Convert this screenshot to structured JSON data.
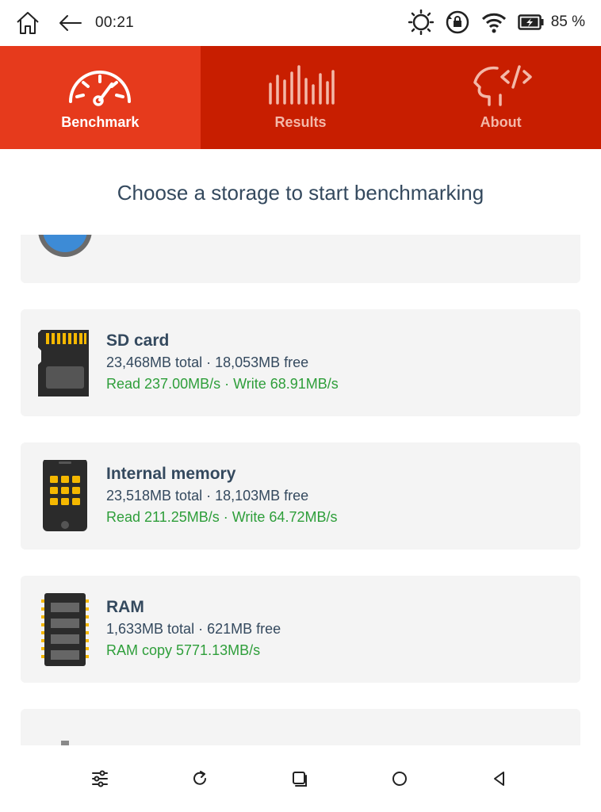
{
  "status_bar": {
    "time": "00:21",
    "battery_percent": "85 %"
  },
  "tabs": [
    {
      "label": "Benchmark",
      "icon": "speedometer-icon",
      "active": true
    },
    {
      "label": "Results",
      "icon": "equalizer-icon",
      "active": false
    },
    {
      "label": "About",
      "icon": "head-code-icon",
      "active": false
    }
  ],
  "heading": "Choose a storage to start benchmarking",
  "storages": [
    {
      "title": "SD card",
      "capacity": "23,468MB total · 18,053MB free",
      "speed": "Read 237.00MB/s · Write 68.91MB/s",
      "icon": "sd-card-icon"
    },
    {
      "title": "Internal memory",
      "capacity": "23,518MB total · 18,103MB free",
      "speed": "Read 211.25MB/s · Write 64.72MB/s",
      "icon": "phone-memory-icon"
    },
    {
      "title": "RAM",
      "capacity": "1,633MB total · 621MB free",
      "speed": "RAM copy 5771.13MB/s",
      "icon": "ram-chip-icon"
    }
  ],
  "colors": {
    "tab_active": "#e63a1c",
    "tab_inactive": "#c81e00",
    "heading_text": "#34495e",
    "speed_text": "#2e9e3a",
    "card_bg": "#f4f4f4"
  },
  "nav_bar": [
    {
      "icon": "sliders-icon"
    },
    {
      "icon": "rotate-icon"
    },
    {
      "icon": "recents-icon"
    },
    {
      "icon": "home-circle-icon"
    },
    {
      "icon": "back-triangle-icon"
    }
  ]
}
